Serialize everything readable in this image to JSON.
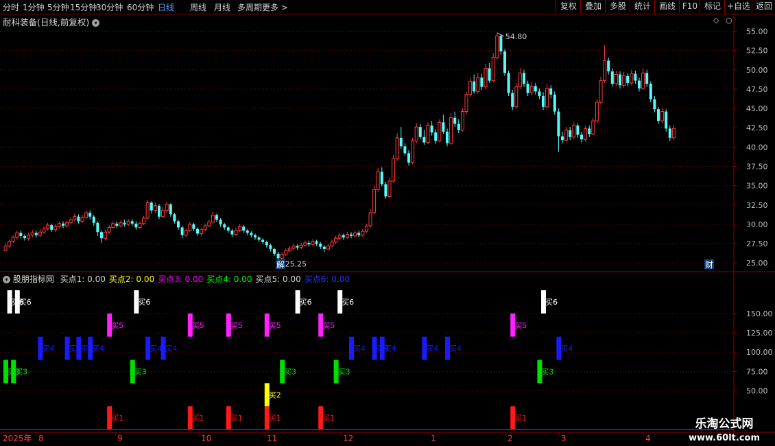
{
  "toolbar": {
    "periods": [
      "分时",
      "1分钟",
      "5分钟",
      "15分钟",
      "30分钟",
      "60分钟",
      "日线",
      "周线",
      "月线",
      "多周期",
      "更多 >"
    ],
    "active_period": "日线",
    "right_buttons": [
      "复权",
      "叠加",
      "多股",
      "统计",
      "画线",
      "F10",
      "标记",
      "+自选",
      "返回"
    ]
  },
  "main_title": "耐科装备(日线,前复权)",
  "indicator": {
    "name": "股朋指标网",
    "values": [
      {
        "label": "买点1:",
        "value": "0.00",
        "color": "#d8d8d8"
      },
      {
        "label": "买点2:",
        "value": "0.00",
        "color": "#ffff00"
      },
      {
        "label": "买点3:",
        "value": "0.00",
        "color": "#ff00ff"
      },
      {
        "label": "买点4:",
        "value": "0.00",
        "color": "#00ff00"
      },
      {
        "label": "买点5:",
        "value": "0.00",
        "color": "#d8d8d8"
      },
      {
        "label": "买点6:",
        "value": "0.00",
        "color": "#3030ff"
      }
    ]
  },
  "watermark": {
    "cn": "乐淘公式网",
    "url": "www.60lt.com"
  },
  "colors": {
    "up": "#ff3d3d",
    "down": "#54fcfc",
    "grid": "#8b0000",
    "axis_text": "#c0c0c0",
    "buy1": "#ff1a1a",
    "buy2": "#ffff00",
    "buy3": "#00e000",
    "buy4": "#1a1aff",
    "buy5": "#ff22ff",
    "buy6": "#ffffff"
  },
  "chart_data": [
    {
      "type": "candlestick",
      "title": "耐科装备(日线,前复权)",
      "y_ticks": [
        "25.00",
        "27.50",
        "30.00",
        "32.50",
        "35.00",
        "37.50",
        "40.00",
        "42.50",
        "45.00",
        "47.50",
        "50.00",
        "52.50",
        "55.00"
      ],
      "ylim": [
        24.4,
        56.2
      ],
      "x_labels": [
        "2025年",
        "8",
        "9",
        "10",
        "11",
        "12",
        "1",
        "2",
        "3",
        "4"
      ],
      "annotations": {
        "high": "54.80",
        "low": "25.25",
        "markers": [
          "解",
          "财"
        ]
      },
      "candles": [
        [
          26.6,
          27.2,
          27.6,
          26.5
        ],
        [
          27.2,
          27.8,
          28.0,
          27.0
        ],
        [
          27.8,
          28.3,
          28.6,
          27.6
        ],
        [
          28.3,
          28.9,
          29.2,
          28.0
        ],
        [
          28.9,
          28.5,
          29.2,
          28.2
        ],
        [
          28.5,
          28.2,
          28.7,
          27.9
        ],
        [
          28.2,
          28.6,
          28.9,
          27.9
        ],
        [
          28.6,
          28.9,
          29.3,
          28.3
        ],
        [
          28.9,
          28.6,
          29.2,
          28.3
        ],
        [
          28.6,
          29.0,
          29.4,
          28.4
        ],
        [
          29.0,
          29.4,
          29.8,
          28.8
        ],
        [
          29.4,
          29.9,
          30.2,
          29.2
        ],
        [
          29.9,
          29.3,
          30.1,
          29.0
        ],
        [
          29.3,
          29.7,
          30.0,
          29.0
        ],
        [
          29.7,
          30.1,
          30.4,
          29.5
        ],
        [
          30.1,
          29.8,
          30.4,
          29.5
        ],
        [
          29.8,
          30.2,
          30.5,
          29.6
        ],
        [
          30.2,
          30.6,
          30.9,
          30.0
        ],
        [
          30.6,
          31.0,
          31.4,
          30.4
        ],
        [
          31.0,
          30.4,
          31.3,
          30.1
        ],
        [
          30.4,
          30.9,
          31.2,
          30.2
        ],
        [
          30.9,
          31.5,
          31.8,
          30.7
        ],
        [
          31.5,
          31.0,
          31.8,
          30.6
        ],
        [
          31.0,
          30.2,
          31.2,
          29.8
        ],
        [
          30.2,
          29.0,
          30.4,
          28.5
        ],
        [
          29.0,
          28.2,
          29.2,
          27.6
        ],
        [
          28.2,
          29.0,
          29.3,
          27.9
        ],
        [
          29.0,
          29.6,
          29.9,
          28.8
        ],
        [
          29.6,
          30.1,
          30.4,
          29.4
        ],
        [
          30.1,
          29.8,
          30.4,
          29.5
        ],
        [
          29.8,
          30.2,
          30.5,
          29.6
        ],
        [
          30.2,
          30.0,
          30.6,
          29.7
        ],
        [
          30.0,
          30.4,
          30.7,
          29.8
        ],
        [
          30.4,
          30.1,
          30.7,
          29.8
        ],
        [
          30.1,
          29.6,
          30.4,
          29.3
        ],
        [
          29.6,
          30.1,
          30.4,
          29.4
        ],
        [
          30.1,
          30.8,
          31.1,
          29.9
        ],
        [
          30.8,
          32.8,
          33.2,
          30.6
        ],
        [
          32.8,
          31.8,
          33.0,
          31.4
        ],
        [
          31.8,
          32.4,
          32.8,
          31.5
        ],
        [
          32.4,
          31.0,
          32.6,
          30.7
        ],
        [
          31.0,
          31.8,
          32.2,
          30.8
        ],
        [
          31.8,
          32.6,
          32.9,
          31.5
        ],
        [
          32.6,
          31.3,
          32.7,
          31.0
        ],
        [
          31.3,
          30.4,
          31.5,
          30.1
        ],
        [
          30.4,
          29.6,
          30.6,
          29.3
        ],
        [
          29.6,
          28.6,
          29.8,
          28.2
        ],
        [
          28.6,
          29.2,
          29.5,
          28.3
        ],
        [
          29.2,
          30.0,
          30.3,
          29.0
        ],
        [
          30.0,
          29.4,
          30.2,
          29.1
        ],
        [
          29.4,
          28.8,
          29.6,
          28.5
        ],
        [
          28.8,
          29.3,
          29.6,
          28.6
        ],
        [
          29.3,
          29.8,
          30.1,
          29.1
        ],
        [
          29.8,
          30.3,
          30.6,
          29.6
        ],
        [
          30.3,
          31.2,
          31.6,
          30.1
        ],
        [
          31.2,
          30.6,
          31.4,
          30.3
        ],
        [
          30.6,
          30.0,
          30.8,
          29.7
        ],
        [
          30.0,
          29.6,
          30.2,
          29.3
        ],
        [
          29.6,
          29.2,
          29.8,
          28.9
        ],
        [
          29.2,
          28.7,
          29.4,
          28.4
        ],
        [
          28.7,
          29.2,
          29.5,
          28.5
        ],
        [
          29.2,
          29.7,
          30.0,
          29.0
        ],
        [
          29.7,
          29.2,
          29.9,
          28.9
        ],
        [
          29.2,
          28.9,
          29.4,
          28.6
        ],
        [
          28.9,
          28.6,
          29.1,
          28.3
        ],
        [
          28.6,
          28.3,
          28.8,
          28.0
        ],
        [
          28.3,
          28.0,
          28.5,
          27.7
        ],
        [
          28.0,
          27.7,
          28.2,
          27.4
        ],
        [
          27.7,
          27.3,
          27.9,
          27.0
        ],
        [
          27.3,
          26.8,
          27.5,
          26.5
        ],
        [
          26.8,
          26.2,
          27.0,
          25.9
        ],
        [
          26.2,
          25.6,
          26.4,
          25.25
        ],
        [
          25.6,
          26.1,
          26.4,
          25.4
        ],
        [
          26.1,
          26.6,
          26.9,
          25.9
        ],
        [
          26.6,
          26.9,
          27.2,
          26.4
        ],
        [
          26.9,
          27.2,
          27.5,
          26.7
        ],
        [
          27.2,
          27.0,
          27.4,
          26.7
        ],
        [
          27.0,
          27.3,
          27.6,
          26.8
        ],
        [
          27.3,
          27.6,
          27.9,
          27.1
        ],
        [
          27.6,
          27.4,
          27.9,
          27.1
        ],
        [
          27.4,
          27.8,
          28.1,
          27.2
        ],
        [
          27.8,
          27.5,
          28.0,
          27.2
        ],
        [
          27.5,
          27.1,
          27.7,
          26.8
        ],
        [
          27.1,
          26.8,
          27.3,
          26.4
        ],
        [
          26.8,
          27.2,
          27.5,
          26.6
        ],
        [
          27.2,
          27.7,
          28.0,
          27.0
        ],
        [
          27.7,
          28.2,
          28.5,
          27.5
        ],
        [
          28.2,
          28.6,
          28.9,
          28.0
        ],
        [
          28.6,
          28.3,
          28.8,
          28.0
        ],
        [
          28.3,
          28.7,
          29.0,
          28.1
        ],
        [
          28.7,
          28.5,
          29.0,
          28.2
        ],
        [
          28.5,
          28.9,
          29.2,
          28.3
        ],
        [
          28.9,
          28.6,
          29.2,
          28.3
        ],
        [
          28.6,
          29.1,
          29.4,
          28.4
        ],
        [
          29.1,
          29.8,
          30.1,
          28.9
        ],
        [
          29.8,
          31.5,
          32.0,
          29.6
        ],
        [
          31.5,
          34.5,
          35.0,
          31.3
        ],
        [
          34.5,
          36.8,
          37.3,
          34.2
        ],
        [
          36.8,
          35.2,
          37.4,
          34.9
        ],
        [
          35.2,
          33.6,
          35.5,
          33.3
        ],
        [
          33.6,
          35.6,
          36.0,
          33.4
        ],
        [
          35.6,
          38.5,
          39.0,
          35.4
        ],
        [
          38.5,
          41.2,
          41.8,
          38.2
        ],
        [
          41.2,
          40.1,
          42.6,
          39.8
        ],
        [
          40.1,
          39.2,
          40.5,
          38.9
        ],
        [
          39.2,
          38.0,
          39.6,
          37.6
        ],
        [
          38.0,
          40.8,
          41.2,
          37.8
        ],
        [
          40.8,
          42.6,
          43.1,
          40.5
        ],
        [
          42.6,
          41.3,
          43.0,
          41.0
        ],
        [
          41.3,
          40.6,
          42.2,
          40.3
        ],
        [
          40.6,
          42.8,
          43.2,
          40.4
        ],
        [
          42.8,
          41.9,
          43.4,
          41.5
        ],
        [
          41.9,
          40.8,
          42.3,
          40.4
        ],
        [
          40.8,
          43.2,
          43.6,
          40.6
        ],
        [
          43.2,
          42.0,
          44.2,
          41.7
        ],
        [
          42.0,
          40.5,
          42.4,
          40.1
        ],
        [
          40.5,
          43.8,
          44.4,
          40.3
        ],
        [
          43.8,
          43.0,
          44.6,
          42.6
        ],
        [
          43.0,
          42.2,
          43.6,
          41.8
        ],
        [
          42.2,
          44.6,
          45.0,
          42.0
        ],
        [
          44.6,
          46.8,
          47.2,
          44.3
        ],
        [
          46.8,
          48.5,
          49.0,
          46.5
        ],
        [
          48.5,
          47.2,
          49.4,
          46.9
        ],
        [
          47.2,
          49.0,
          49.6,
          46.9
        ],
        [
          49.0,
          47.8,
          49.5,
          47.4
        ],
        [
          47.8,
          50.2,
          50.8,
          47.5
        ],
        [
          50.2,
          48.6,
          50.9,
          48.3
        ],
        [
          48.6,
          51.6,
          52.2,
          48.4
        ],
        [
          51.6,
          54.4,
          54.8,
          51.3
        ],
        [
          54.4,
          52.4,
          54.6,
          51.9
        ],
        [
          52.4,
          49.6,
          52.7,
          49.2
        ],
        [
          49.6,
          47.0,
          49.9,
          46.6
        ],
        [
          47.0,
          45.2,
          47.4,
          44.8
        ],
        [
          45.2,
          47.8,
          48.3,
          45.0
        ],
        [
          47.8,
          49.6,
          50.2,
          47.5
        ],
        [
          49.6,
          48.2,
          50.0,
          47.8
        ],
        [
          48.2,
          47.0,
          48.6,
          46.6
        ],
        [
          47.0,
          47.9,
          48.4,
          46.7
        ],
        [
          47.9,
          47.2,
          48.3,
          46.8
        ],
        [
          47.2,
          46.6,
          47.6,
          46.2
        ],
        [
          46.6,
          45.2,
          47.1,
          44.8
        ],
        [
          45.2,
          47.6,
          48.2,
          45.0
        ],
        [
          47.6,
          46.8,
          48.0,
          46.3
        ],
        [
          46.8,
          44.6,
          47.2,
          44.2
        ],
        [
          44.6,
          41.4,
          45.0,
          39.4
        ],
        [
          41.4,
          40.9,
          42.0,
          40.5
        ],
        [
          40.9,
          42.2,
          42.6,
          40.6
        ],
        [
          42.2,
          41.3,
          42.6,
          40.9
        ],
        [
          41.3,
          42.8,
          43.2,
          41.0
        ],
        [
          42.8,
          41.6,
          43.1,
          41.2
        ],
        [
          41.6,
          41.0,
          42.0,
          40.6
        ],
        [
          41.0,
          42.4,
          42.8,
          40.7
        ],
        [
          42.4,
          41.7,
          42.8,
          41.3
        ],
        [
          41.7,
          43.4,
          43.8,
          41.5
        ],
        [
          43.4,
          45.8,
          46.2,
          43.1
        ],
        [
          45.8,
          48.6,
          49.1,
          45.5
        ],
        [
          48.6,
          51.2,
          53.2,
          48.3
        ],
        [
          51.2,
          49.8,
          51.6,
          49.4
        ],
        [
          49.8,
          48.2,
          50.2,
          47.8
        ],
        [
          48.2,
          49.4,
          49.9,
          47.9
        ],
        [
          49.4,
          48.0,
          49.8,
          47.6
        ],
        [
          48.0,
          49.2,
          49.7,
          47.7
        ],
        [
          49.2,
          48.3,
          49.6,
          47.9
        ],
        [
          48.3,
          49.5,
          50.0,
          48.0
        ],
        [
          49.5,
          48.6,
          49.9,
          48.2
        ],
        [
          48.6,
          47.6,
          49.0,
          47.2
        ],
        [
          47.6,
          49.6,
          50.2,
          47.4
        ],
        [
          49.6,
          48.2,
          50.0,
          47.8
        ],
        [
          48.2,
          46.2,
          48.5,
          45.8
        ],
        [
          46.2,
          44.9,
          46.6,
          44.5
        ],
        [
          44.9,
          43.4,
          45.2,
          43.0
        ],
        [
          43.4,
          44.6,
          45.0,
          43.1
        ],
        [
          44.6,
          42.4,
          44.9,
          42.0
        ],
        [
          42.4,
          41.2,
          42.8,
          40.8
        ],
        [
          41.2,
          42.4,
          42.8,
          40.9
        ]
      ]
    },
    {
      "type": "bar",
      "title": "股朋指标网",
      "y_ticks": [
        "50.00",
        "75.00",
        "100.00",
        "125.00",
        "150.00"
      ],
      "ylim": [
        0,
        188
      ],
      "series": [
        {
          "name": "买点1",
          "label": "买1",
          "bottom": 0,
          "top": 30,
          "positions": [
            27,
            48,
            58,
            68,
            82,
            132
          ],
          "color": "#ff1a1a"
        },
        {
          "name": "买点2",
          "label": "买2",
          "bottom": 30,
          "top": 60,
          "positions": [
            68
          ],
          "color": "#ffff00"
        },
        {
          "name": "买点3",
          "label": "买3",
          "bottom": 60,
          "top": 90,
          "positions": [
            0,
            2,
            33,
            72,
            86,
            139
          ],
          "color": "#00e000"
        },
        {
          "name": "买点4",
          "label": "买4",
          "bottom": 90,
          "top": 120,
          "positions": [
            9,
            16,
            19,
            22,
            37,
            41,
            90,
            96,
            98,
            109,
            115,
            144
          ],
          "color": "#1a1aff"
        },
        {
          "name": "买点5",
          "label": "买5",
          "bottom": 120,
          "top": 150,
          "positions": [
            27,
            48,
            58,
            68,
            82,
            132
          ],
          "color": "#ff22ff"
        },
        {
          "name": "买点6",
          "label": "买6",
          "bottom": 150,
          "top": 180,
          "positions": [
            1,
            3,
            34,
            76,
            87,
            140
          ],
          "color": "#ffffff"
        }
      ]
    }
  ]
}
